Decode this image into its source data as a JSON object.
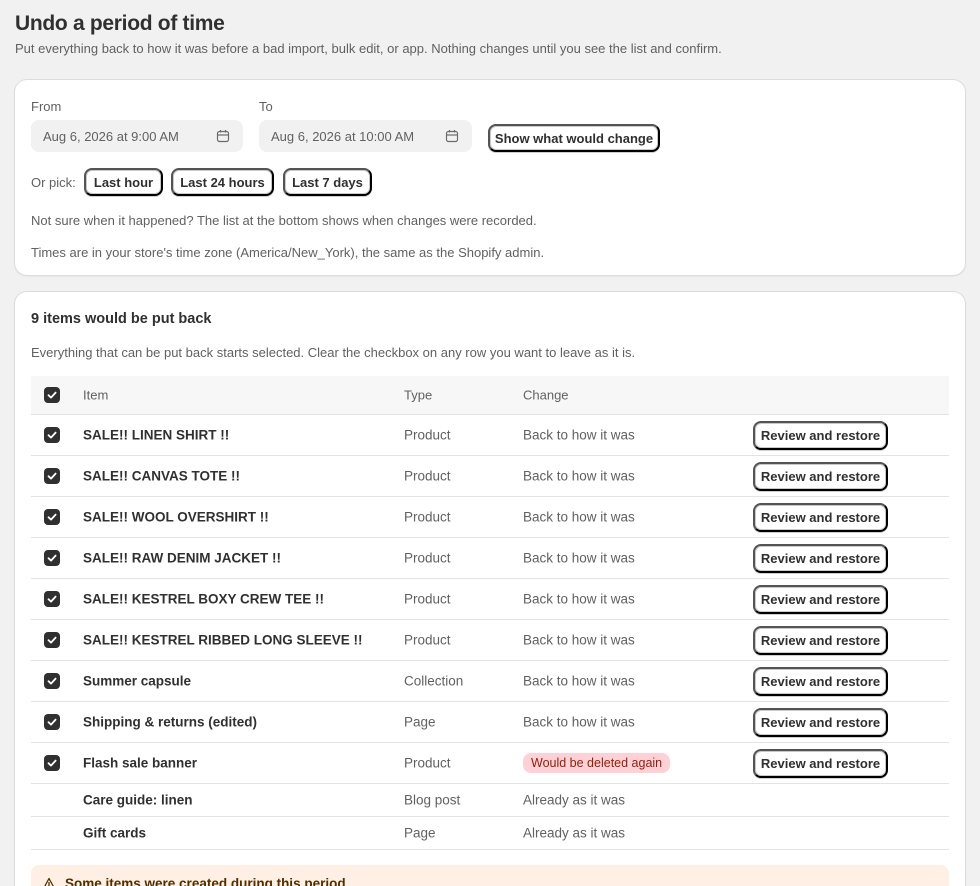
{
  "page": {
    "title": "Undo a period of time",
    "subtitle": "Put everything back to how it was before a bad import, bulk edit, or app. Nothing changes until you see the list and confirm."
  },
  "range": {
    "from_label": "From",
    "from_value": "Aug 6, 2026 at 9:00 AM",
    "to_label": "To",
    "to_value": "Aug 6, 2026 at 10:00 AM",
    "show_button": "Show what would change",
    "pick_label": "Or pick:",
    "quick_picks": [
      "Last hour",
      "Last 24 hours",
      "Last 7 days"
    ],
    "hint_when": "Not sure when it happened? The list at the bottom shows when changes were recorded.",
    "hint_timezone": "Times are in your store's time zone (America/New_York), the same as the Shopify admin."
  },
  "results": {
    "title": "9 items would be put back",
    "description": "Everything that can be put back starts selected. Clear the checkbox on any row you want to leave as it is.",
    "columns": {
      "item": "Item",
      "type": "Type",
      "change": "Change"
    },
    "rows": [
      {
        "item": "SALE!! LINEN SHIRT !!",
        "type": "Product",
        "change": "Back to how it was",
        "action": "Review and restore"
      },
      {
        "item": "SALE!! CANVAS TOTE !!",
        "type": "Product",
        "change": "Back to how it was",
        "action": "Review and restore"
      },
      {
        "item": "SALE!! WOOL OVERSHIRT !!",
        "type": "Product",
        "change": "Back to how it was",
        "action": "Review and restore"
      },
      {
        "item": "SALE!! RAW DENIM JACKET !!",
        "type": "Product",
        "change": "Back to how it was",
        "action": "Review and restore"
      },
      {
        "item": "SALE!! KESTREL BOXY CREW TEE !!",
        "type": "Product",
        "change": "Back to how it was",
        "action": "Review and restore"
      },
      {
        "item": "SALE!! KESTREL RIBBED LONG SLEEVE !!",
        "type": "Product",
        "change": "Back to how it was",
        "action": "Review and restore"
      },
      {
        "item": "Summer capsule",
        "type": "Collection",
        "change": "Back to how it was",
        "action": "Review and restore"
      },
      {
        "item": "Shipping & returns (edited)",
        "type": "Page",
        "change": "Back to how it was",
        "action": "Review and restore"
      },
      {
        "item": "Flash sale banner",
        "type": "Product",
        "change": "Would be deleted again",
        "action": "Review and restore"
      }
    ],
    "unchanged_rows": [
      {
        "item": "Care guide: linen",
        "type": "Blog post",
        "change": "Already as it was"
      },
      {
        "item": "Gift cards",
        "type": "Page",
        "change": "Already as it was"
      }
    ],
    "banner_title": "Some items were created during this period"
  },
  "colors": {
    "accent": "#303030",
    "critical_bg": "#fed1d7",
    "critical_text": "#8e1f0b",
    "warning_bg": "#ffefe4"
  },
  "icons": [
    "calendar-icon",
    "checkmark-icon",
    "warning-icon"
  ]
}
